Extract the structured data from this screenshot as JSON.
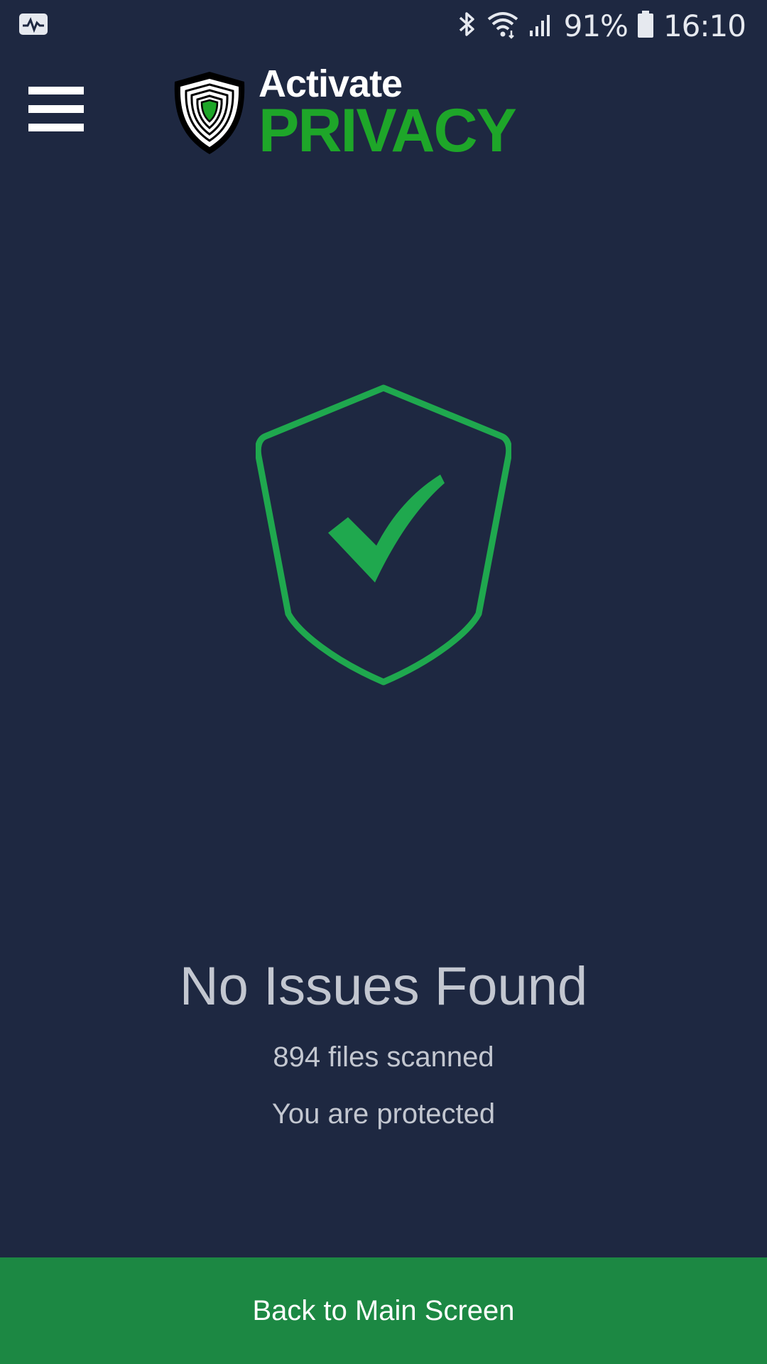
{
  "status_bar": {
    "battery_percent": "91%",
    "time": "16:10",
    "icons": [
      "activity-monitor-icon",
      "bluetooth-icon",
      "wifi-icon",
      "signal-icon",
      "battery-icon"
    ]
  },
  "header": {
    "logo_line1": "Activate",
    "logo_line2": "PRIVACY",
    "menu_icon": "hamburger-menu-icon"
  },
  "result": {
    "icon": "shield-check-icon",
    "title": "No Issues Found",
    "files_scanned": "894 files scanned",
    "status": "You are protected"
  },
  "footer": {
    "back_label": "Back to Main Screen"
  },
  "colors": {
    "background": "#1e2841",
    "accent_green": "#1ea629",
    "shield_green": "#1fa84e",
    "button_green": "#1c8843",
    "text_muted": "#c3c7d0"
  }
}
